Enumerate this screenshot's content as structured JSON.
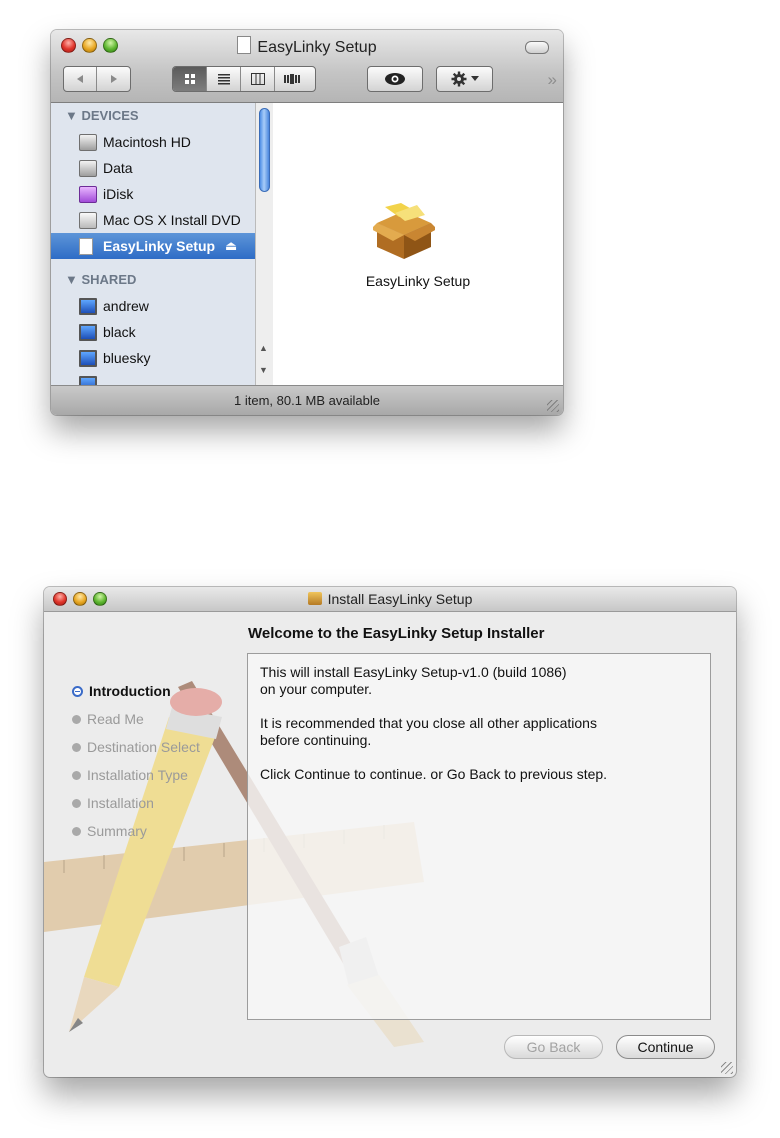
{
  "finder": {
    "title": "EasyLinky Setup",
    "toolbar": {
      "back_icon": "back-arrow-icon",
      "forward_icon": "forward-arrow-icon",
      "view_modes": [
        "icon-view",
        "list-view",
        "column-view",
        "cover-flow-view"
      ],
      "active_view": "icon-view",
      "quick_look_icon": "eye-icon",
      "action_icon": "gear-icon"
    },
    "sidebar": {
      "devices_header": "DEVICES",
      "devices": [
        {
          "label": "Macintosh HD",
          "icon": "hard-disk-icon"
        },
        {
          "label": "Data",
          "icon": "hard-disk-icon"
        },
        {
          "label": "iDisk",
          "icon": "idisk-icon"
        },
        {
          "label": "Mac OS X Install DVD",
          "icon": "dvd-icon"
        },
        {
          "label": "EasyLinky Setup",
          "icon": "disk-image-icon",
          "selected": true
        }
      ],
      "shared_header": "SHARED",
      "shared": [
        {
          "label": "andrew",
          "icon": "computer-icon"
        },
        {
          "label": "black",
          "icon": "computer-icon"
        },
        {
          "label": "bluesky",
          "icon": "computer-icon"
        }
      ]
    },
    "content": {
      "items": [
        {
          "label": "EasyLinky Setup",
          "icon": "package-icon"
        }
      ]
    },
    "status": "1 item, 80.1 MB available"
  },
  "installer": {
    "title": "Install EasyLinky Setup",
    "heading": "Welcome to the EasyLinky Setup Installer",
    "steps": [
      "Introduction",
      "Read Me",
      "Destination Select",
      "Installation Type",
      "Installation",
      "Summary"
    ],
    "current_step": "Introduction",
    "body": [
      "This will install EasyLinky Setup-v1.0 (build 1086)\non your computer.",
      "It is recommended that you close all other applications\nbefore continuing.",
      "Click Continue to continue. or Go Back to previous step."
    ],
    "buttons": {
      "back": "Go Back",
      "continue": "Continue"
    },
    "colors": {
      "step_bullet_current": "#3a6bc8",
      "step_inactive": "#9a9a9a"
    }
  }
}
